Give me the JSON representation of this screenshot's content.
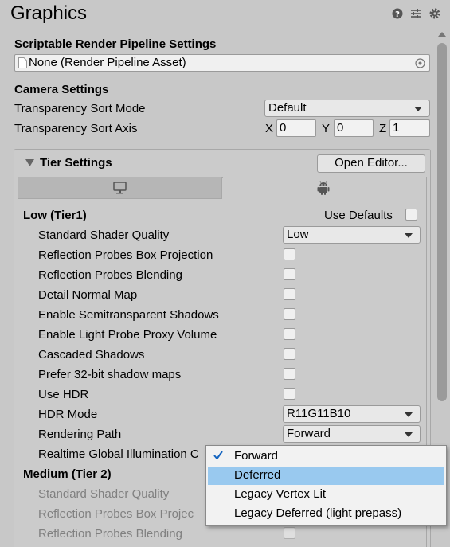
{
  "header": {
    "title": "Graphics"
  },
  "srp": {
    "heading": "Scriptable Render Pipeline Settings",
    "asset_value": "None (Render Pipeline Asset)"
  },
  "camera": {
    "heading": "Camera Settings",
    "sort_mode_label": "Transparency Sort Mode",
    "sort_mode_value": "Default",
    "sort_axis_label": "Transparency Sort Axis",
    "x_label": "X",
    "x_value": "0",
    "y_label": "Y",
    "y_value": "0",
    "z_label": "Z",
    "z_value": "1"
  },
  "tier": {
    "heading": "Tier Settings",
    "open_editor": "Open Editor...",
    "tabs": [
      {
        "icon": "monitor-icon",
        "selected": false
      },
      {
        "icon": "android-icon",
        "selected": true
      }
    ],
    "low": {
      "title": "Low (Tier1)",
      "use_defaults_label": "Use Defaults",
      "rows": {
        "shader_quality": {
          "label": "Standard Shader Quality",
          "value": "Low"
        },
        "box_projection": "Reflection Probes Box Projection",
        "blending": "Reflection Probes Blending",
        "detail_normal": "Detail Normal Map",
        "semitransparent": "Enable Semitransparent Shadows",
        "light_probe_proxy": "Enable Light Probe Proxy Volume",
        "cascaded": "Cascaded Shadows",
        "shadow_32bit": "Prefer 32-bit shadow maps",
        "use_hdr": "Use HDR",
        "hdr_mode": {
          "label": "HDR Mode",
          "value": "R11G11B10"
        },
        "rendering_path": {
          "label": "Rendering Path",
          "value": "Forward"
        },
        "realtime_gi": "Realtime Global Illumination C"
      }
    },
    "medium": {
      "title": "Medium (Tier 2)",
      "rows": {
        "shader_quality": "Standard Shader Quality",
        "box_projection": "Reflection Probes Box Projec",
        "blending": "Reflection Probes Blending"
      }
    }
  },
  "popup": {
    "items": [
      {
        "label": "Forward",
        "checked": true
      },
      {
        "label": "Deferred",
        "highlighted": true
      },
      {
        "label": "Legacy Vertex Lit"
      },
      {
        "label": "Legacy Deferred (light prepass)"
      }
    ]
  },
  "colors": {
    "background": "#c8c8c8",
    "highlight": "#99c9ef",
    "check": "#1565c0"
  }
}
